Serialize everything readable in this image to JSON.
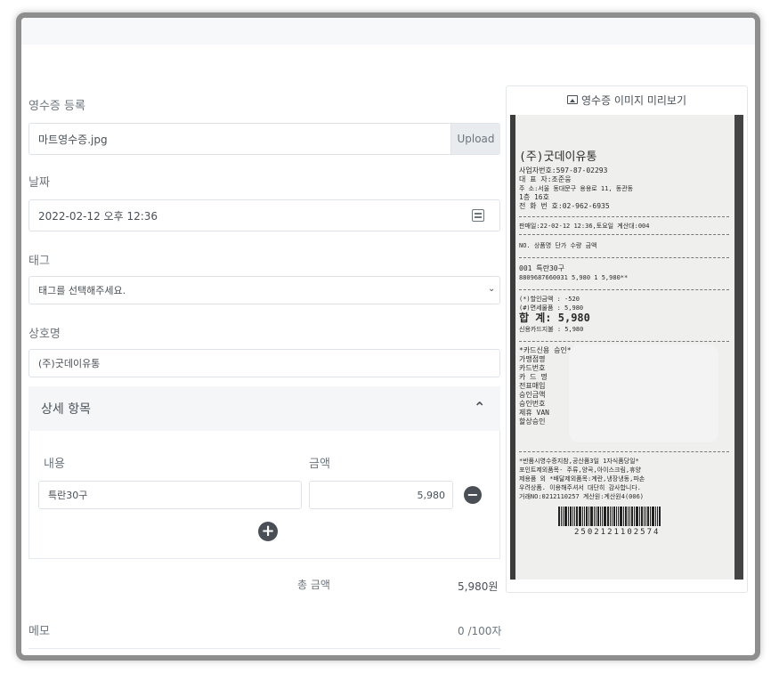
{
  "form": {
    "receipt_label": "영수증 등록",
    "file_name": "마트영수증.jpg",
    "upload_label": "Upload",
    "date_label": "날짜",
    "date_value": "2022-02-12 오후 12:36",
    "tag_label": "태그",
    "tag_placeholder": "태그를 선택해주세요.",
    "store_label": "상호명",
    "store_value": "(주)굿데이유통",
    "details_label": "상세 항목",
    "col_content": "내용",
    "col_amount": "금액",
    "item_content": "특란30구",
    "item_amount": "5,980",
    "total_label": "총 금액",
    "total_value": "5,980원",
    "memo_label": "메모",
    "memo_count": "0 /100자"
  },
  "preview": {
    "title": "영수증 이미지 미리보기",
    "receipt_lines": [
      "(주)굿데이유통",
      "사업자번호:597-87-02293",
      "대  표  자:조준웅",
      "주     소:서울 동대문구 용용로 11, 동관동",
      " 1층 16호",
      "전 화 번 호:02-962-6935",
      "판매일:22-02-12 12:36,토요일 계산대:004",
      "NO.  상품명         단가   수량    금액",
      "001 특란30구",
      "     8809687660031  5,980    1   5,980**",
      "(*)할인금액 :                      -520",
      "(#)면세물품 :                     5,980",
      "합      계:               5,980",
      "신용카드지불 :                    5,980",
      "*카드신용 승인*",
      "가맹점명",
      "카드번호",
      "카 드 명",
      "전표매입",
      "승인금액",
      "승인번호",
      "제휴 VAN",
      "할상승인",
      "*반품시영수증지참,공산품3일 1자식품당일*",
      "포인트제외품목- 주류,양곡,아이스크림,휴양",
      "제용품 외 *배달제외품목:계란,냉장냉동,파손",
      "우려상품. 이용해주셔서 대단히 감사합니다.",
      "거래NO:0212110257 계산원:계산원4(006)",
      "2502121102574"
    ]
  }
}
